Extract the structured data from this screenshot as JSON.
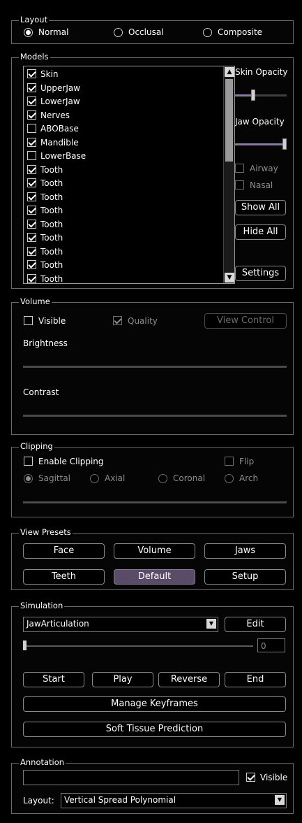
{
  "layout": {
    "title": "Layout",
    "options": [
      "Normal",
      "Occlusal",
      "Composite"
    ],
    "selected": "Normal"
  },
  "models": {
    "title": "Models",
    "items": [
      {
        "label": "Skin",
        "checked": true
      },
      {
        "label": "UpperJaw",
        "checked": true
      },
      {
        "label": "LowerJaw",
        "checked": true
      },
      {
        "label": "Nerves",
        "checked": true
      },
      {
        "label": "ABOBase",
        "checked": false
      },
      {
        "label": "Mandible",
        "checked": true
      },
      {
        "label": "LowerBase",
        "checked": false
      },
      {
        "label": "Tooth",
        "checked": true
      },
      {
        "label": "Tooth",
        "checked": true
      },
      {
        "label": "Tooth",
        "checked": true
      },
      {
        "label": "Tooth",
        "checked": true
      },
      {
        "label": "Tooth",
        "checked": true
      },
      {
        "label": "Tooth",
        "checked": true
      },
      {
        "label": "Tooth",
        "checked": true
      },
      {
        "label": "Tooth",
        "checked": true
      },
      {
        "label": "Tooth",
        "checked": true
      }
    ],
    "skin_opacity_label": "Skin Opacity",
    "skin_opacity": 0.35,
    "jaw_opacity_label": "Jaw Opacity",
    "jaw_opacity": 1.0,
    "airway_label": "Airway",
    "nasal_label": "Nasal",
    "show_all": "Show All",
    "hide_all": "Hide All",
    "settings": "Settings"
  },
  "volume": {
    "title": "Volume",
    "visible_label": "Visible",
    "quality_label": "Quality",
    "view_control": "View Control",
    "brightness_label": "Brightness",
    "contrast_label": "Contrast"
  },
  "clipping": {
    "title": "Clipping",
    "enable_label": "Enable Clipping",
    "flip_label": "Flip",
    "planes": [
      "Sagittal",
      "Axial",
      "Coronal",
      "Arch"
    ],
    "selected": "Sagittal"
  },
  "view_presets": {
    "title": "View Presets",
    "buttons": [
      "Face",
      "Volume",
      "Jaws",
      "Teeth",
      "Default",
      "Setup"
    ],
    "active": "Default",
    "active_color": "#5a4b68"
  },
  "simulation": {
    "title": "Simulation",
    "combo_value": "JawArticulation",
    "edit": "Edit",
    "frame_value": "0",
    "start": "Start",
    "play": "Play",
    "reverse": "Reverse",
    "end": "End",
    "manage_keyframes": "Manage Keyframes",
    "soft_tissue": "Soft Tissue Prediction"
  },
  "annotation": {
    "title": "Annotation",
    "text_value": "",
    "visible_label": "Visible",
    "layout_label": "Layout:",
    "layout_value": "Vertical Spread Polynomial"
  }
}
